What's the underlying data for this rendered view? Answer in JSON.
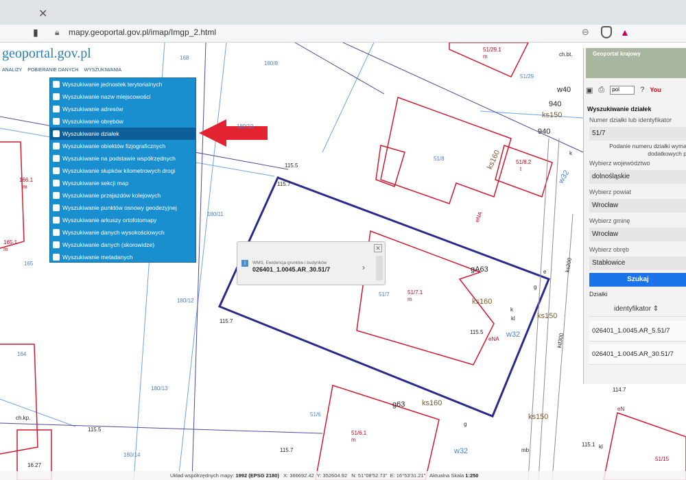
{
  "browser": {
    "url": "mapy.geoportal.gov.pl/imap/Imgp_2.html"
  },
  "app": {
    "logo_text": "geoportal.gov.pl",
    "menu": [
      "ANALIZY",
      "POBIERANIE DANYCH",
      "WYSZUKIWANIA"
    ]
  },
  "dropdown": {
    "items": [
      "Wyszukiwanie jednostek terytorialnych",
      "Wyszukiwanie nazw miejscowości",
      "Wyszukiwanie adresów",
      "Wyszukiwanie obrębów",
      "Wyszukiwanie działek",
      "Wyszukiwanie obiektów fizjograficznych",
      "Wyszukiwanie na podstawie współrzędnych",
      "Wyszukiwanie słupków kilometrowych drogi",
      "Wyszukiwanie sekcji map",
      "Wyszukiwanie przejazdów kolejowych",
      "Wyszukiwanie punktów osnowy geodezyjnej",
      "Wyszukiwanie arkuszy ortofotomapy",
      "Wyszukiwanie danych wysokościowych",
      "Wyszukiwanie danych (skorowidze)",
      "Wyszukiwanie metadanych"
    ],
    "active_index": 4
  },
  "popup": {
    "subtitle": "WMS, Ewidencja gruntów i budynków",
    "id": "026401_1.0045.AR_30.51/7"
  },
  "panel": {
    "mini_map_label": "Geoportal krajowy",
    "lang": "pol",
    "yt_label": "You",
    "title": "Wyszukiwanie działek",
    "number_label": "Numer działki lub identyfikator",
    "number_value": "51/7",
    "note": "Podanie numeru działki wyma dodatkowych p",
    "voiv_label": "Wybierz województwo",
    "voiv_value": "dolnośląskie",
    "county_label": "Wybierz powiat",
    "county_value": "Wrocław",
    "commune_label": "Wybierz gminę",
    "commune_value": "Wrocław",
    "precinct_label": "Wybierz obręb",
    "precinct_value": "Stabłowice",
    "search_button": "Szukaj",
    "results_label": "Działki",
    "table_header": "identyfikator",
    "results": [
      "026401_1.0045.AR_5.51/7",
      "026401_1.0045.AR_30.51/7"
    ]
  },
  "status": {
    "crs_label": "Układ współrzędnych mapy:",
    "crs": "1992 (EPSG 2180)",
    "x": "X: 366692.42",
    "y": "Y: 352604.92",
    "n": "N: 51°08'52.73\"",
    "e": "E: 16°53'31.21\"",
    "scale_label": "Aktualna Skala",
    "scale": "1:250"
  },
  "map_labels": {
    "blue": [
      "168",
      "180/8",
      "180/10",
      "180/11",
      "180/12",
      "180/13",
      "180/14",
      "165",
      "164",
      "51/8",
      "51/7",
      "51/6",
      "51/29",
      "40"
    ],
    "red": [
      "166.1",
      "165.1",
      "51/29.1",
      "51/8.2",
      "51/7.1",
      "51/6.1",
      "51/15",
      "eNA",
      "eN"
    ],
    "red_m": [
      "m",
      "m",
      "m",
      "m",
      "m",
      "t"
    ],
    "black": [
      "115.5",
      "115.7",
      "115.5",
      "115.7",
      "115.5",
      "115.7",
      "114.7",
      "115.1",
      "gA63",
      "g63",
      "w40",
      "940",
      "940",
      "ks150",
      "ks160",
      "ks160",
      "ks150",
      "ks150",
      "ks160",
      "w32",
      "w32",
      "w32",
      "kd300",
      "ch.kp.",
      "ch.bt.",
      "16.27",
      "k",
      "kl",
      "kl",
      "k",
      "mb",
      "e",
      "g",
      "g",
      "ks200"
    ]
  }
}
